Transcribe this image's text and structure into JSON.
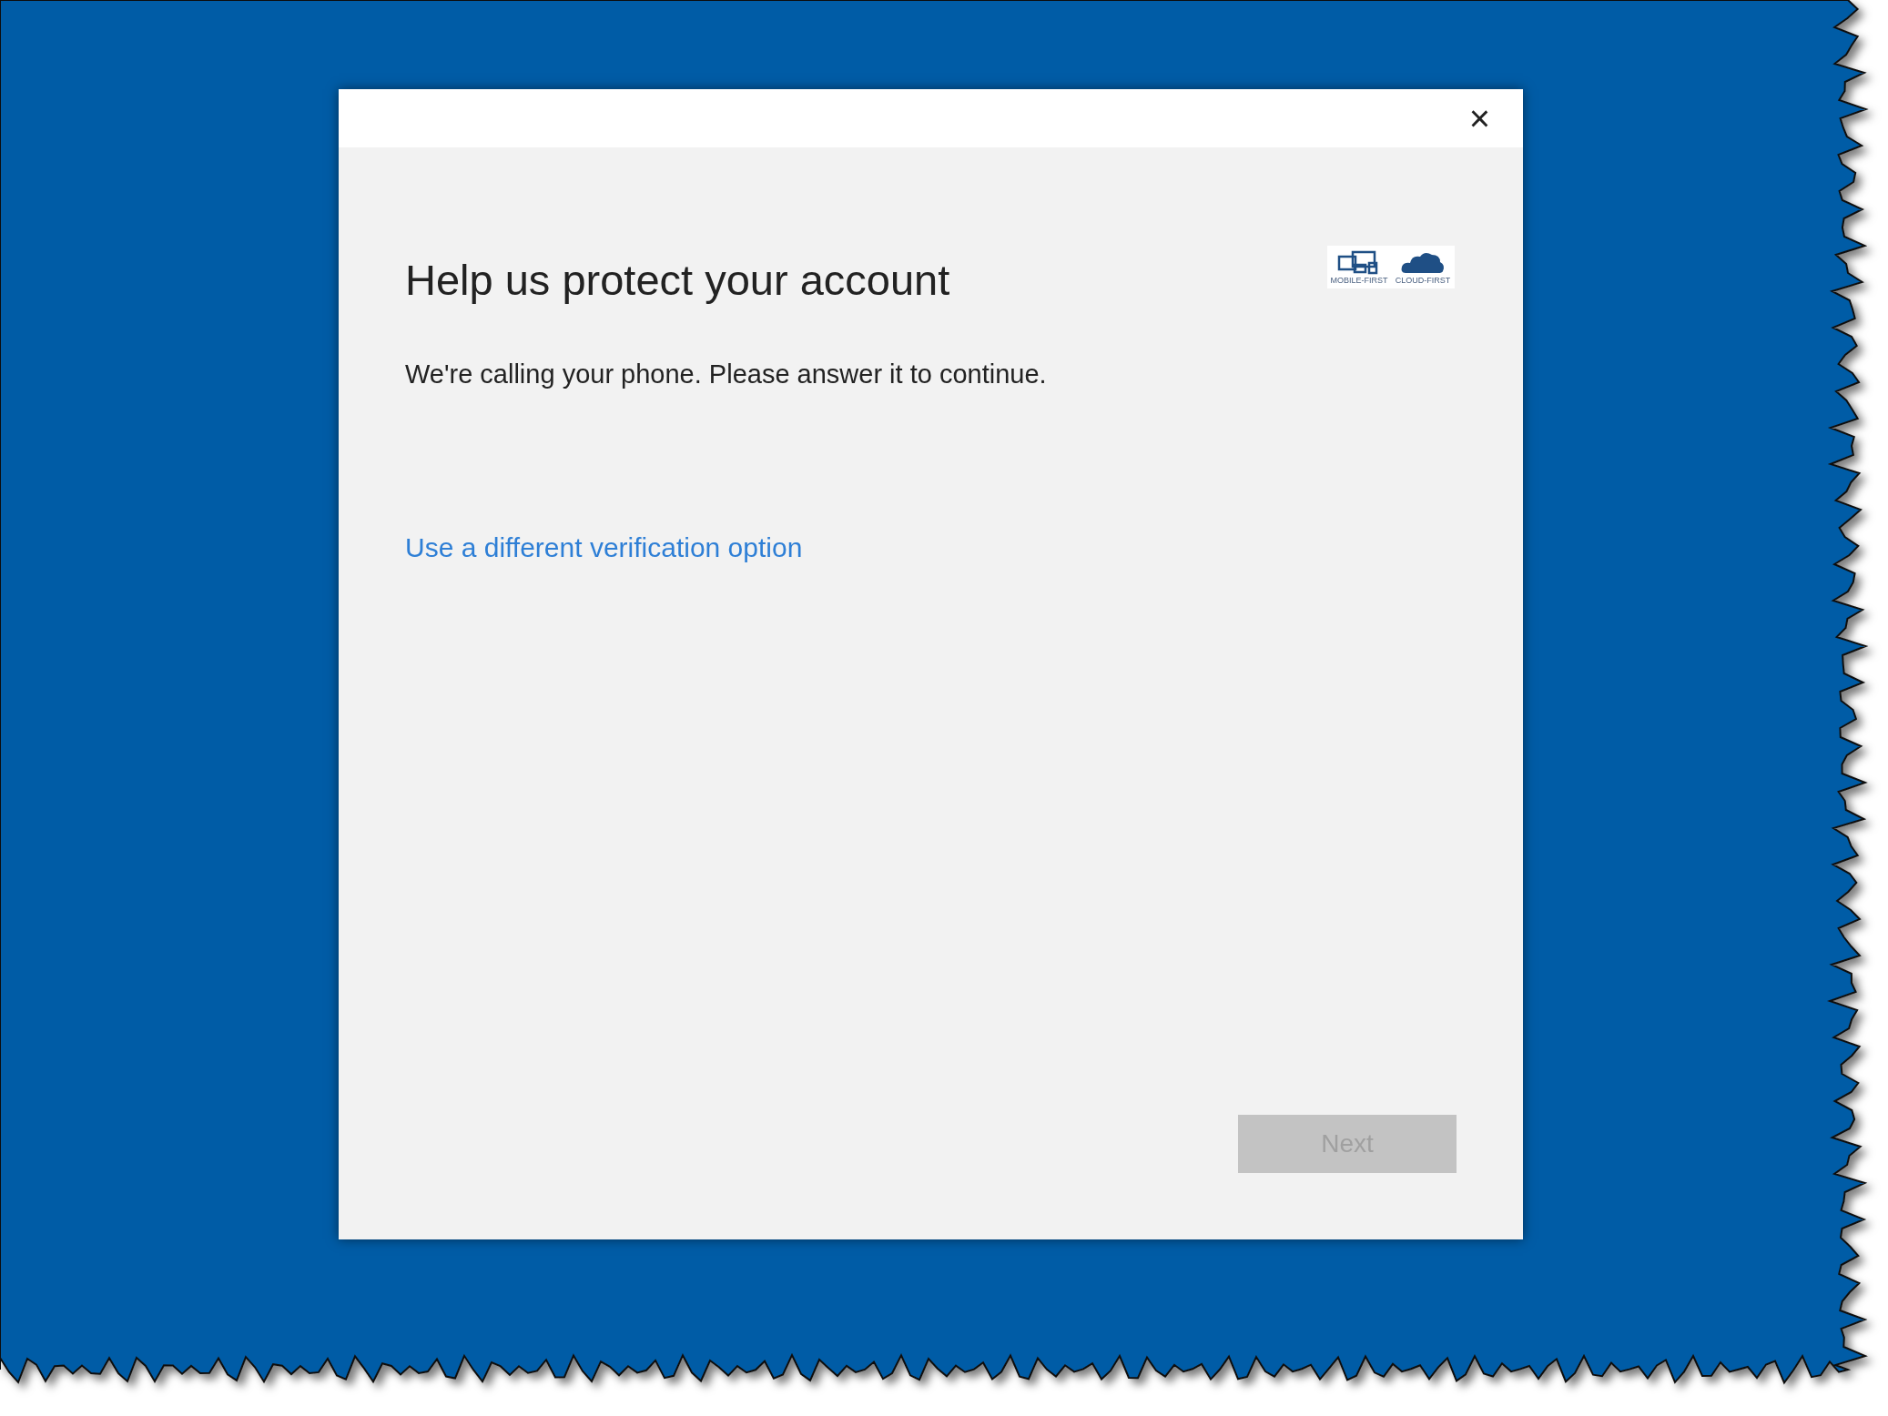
{
  "dialog": {
    "close_label": "×",
    "heading": "Help us protect your account",
    "message": "We're calling your phone. Please answer it to continue.",
    "link": "Use a different verification option",
    "logo": [
      "MOBILE-FIRST",
      "CLOUD-FIRST"
    ],
    "next_button": {
      "label": "Next",
      "disabled": true
    }
  }
}
